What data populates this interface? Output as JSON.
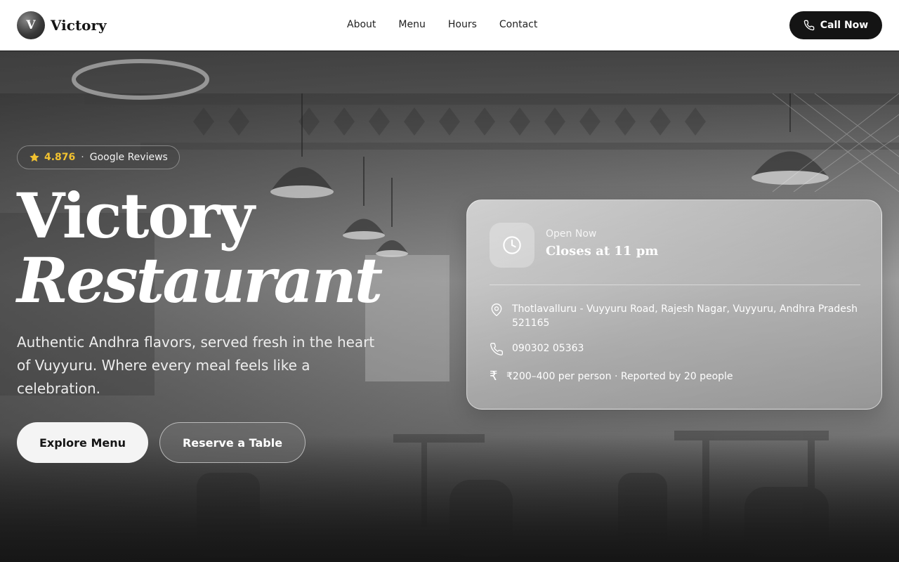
{
  "brand": {
    "mark": "V",
    "name": "Victory"
  },
  "nav": {
    "links": [
      "About",
      "Menu",
      "Hours",
      "Contact"
    ],
    "call_label": "Call Now"
  },
  "hero": {
    "rating": {
      "value": "4.876",
      "separator": "·",
      "source": "Google Reviews"
    },
    "title_line1": "Victory",
    "title_line2": "Restaurant",
    "tagline": "Authentic Andhra flavors, served fresh in the heart of Vuyyuru. Where every meal feels like a celebration.",
    "primary_button": "Explore Menu",
    "secondary_button": "Reserve a Table"
  },
  "info_card": {
    "status": "Open Now",
    "closing": "Closes at 11 pm",
    "address": "Thotlavalluru - Vuyyuru Road, Rajesh Nagar, Vuyyuru, Andhra Pradesh 521165",
    "phone": "090302 05363",
    "price_symbol": "₹",
    "price": "₹200–400 per person · Reported by 20 people"
  },
  "icons": {
    "brand": "brand-logo-icon",
    "call": "phone-icon",
    "rating": "star-icon",
    "hours": "clock-icon",
    "address": "map-pin-icon",
    "phone": "phone-icon",
    "price": "rupee-icon"
  },
  "colors": {
    "nav_bg": "#ffffff",
    "call_button": "#141414",
    "rating_star": "#f2c230",
    "primary_button_bg": "#f4f4f4"
  }
}
